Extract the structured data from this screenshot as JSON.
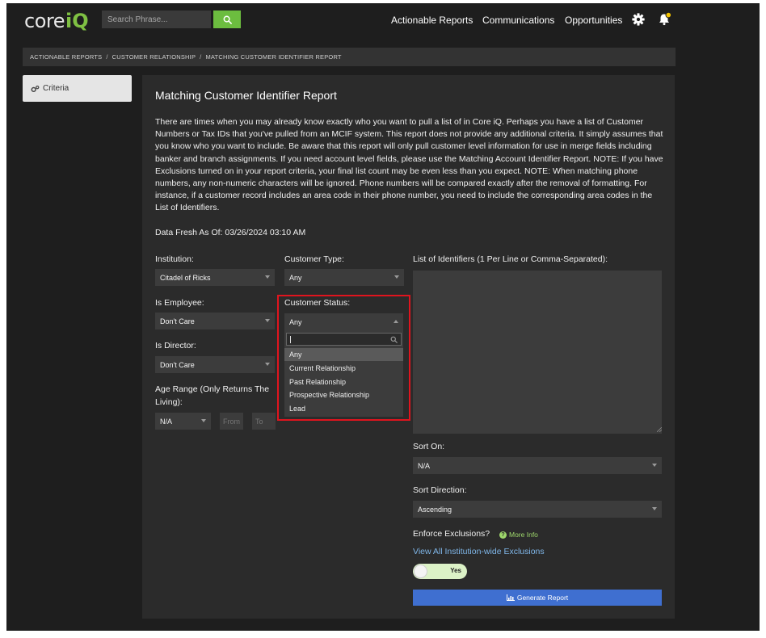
{
  "logo": {
    "core": "core",
    "iq": "iQ"
  },
  "search": {
    "placeholder": "Search Phrase..."
  },
  "nav": {
    "actionable_reports": "Actionable Reports",
    "communications": "Communications",
    "opportunities": "Opportunities"
  },
  "breadcrumb": {
    "items": [
      "ACTIONABLE REPORTS",
      "CUSTOMER RELATIONSHIP",
      "MATCHING CUSTOMER IDENTIFIER REPORT"
    ],
    "separator": "/"
  },
  "sidebar": {
    "criteria_label": "Criteria"
  },
  "report": {
    "title": "Matching Customer Identifier Report",
    "description": "There are times when you may already know exactly who you want to pull a list of in Core iQ. Perhaps you have a list of Customer Numbers or Tax IDs that you've pulled from an MCIF system. This report does not provide any additional criteria. It simply assumes that you know who you want to include. Be aware that this report will only pull customer level information for use in merge fields including banker and branch assignments. If you need account level fields, please use the Matching Account Identifier Report. NOTE: If you have Exclusions turned on in your report criteria, your final list count may be even less than you expect. NOTE: When matching phone numbers, any non-numeric characters will be ignored. Phone numbers will be compared exactly after the removal of formatting. For instance, if a customer record includes an area code in their phone number, you need to include the corresponding area codes in the List of Identifiers.",
    "data_fresh": "Data Fresh As Of: 03/26/2024 03:10 AM"
  },
  "form": {
    "institution": {
      "label": "Institution:",
      "value": "Citadel of Ricks"
    },
    "customer_type": {
      "label": "Customer Type:",
      "value": "Any"
    },
    "is_employee": {
      "label": "Is Employee:",
      "value": "Don't Care"
    },
    "customer_status": {
      "label": "Customer Status:",
      "value": "Any",
      "options": [
        "Any",
        "Current Relationship",
        "Past Relationship",
        "Prospective Relationship",
        "Lead"
      ]
    },
    "is_director": {
      "label": "Is Director:",
      "value": "Don't Care"
    },
    "age_range": {
      "label": "Age Range (Only Returns The Living):",
      "value": "N/A",
      "from_placeholder": "From",
      "to_placeholder": "To"
    },
    "identifiers": {
      "label": "List of Identifiers (1 Per Line or Comma-Separated):",
      "value": ""
    },
    "sort_on": {
      "label": "Sort On:",
      "value": "N/A"
    },
    "sort_direction": {
      "label": "Sort Direction:",
      "value": "Ascending"
    },
    "enforce_exclusions": {
      "label": "Enforce Exclusions?",
      "more_info": "More Info",
      "toggle_text": "Yes",
      "enabled": true
    },
    "view_exclusions_link": "View All Institution-wide Exclusions",
    "generate_button": "Generate Report"
  },
  "colors": {
    "background": "#1e1e1e",
    "panel": "#2b2b2b",
    "accent_green": "#6cbd3f",
    "button_blue": "#3f6fd0",
    "link_blue": "#7fb6e8",
    "highlight_red": "#e0141e"
  }
}
